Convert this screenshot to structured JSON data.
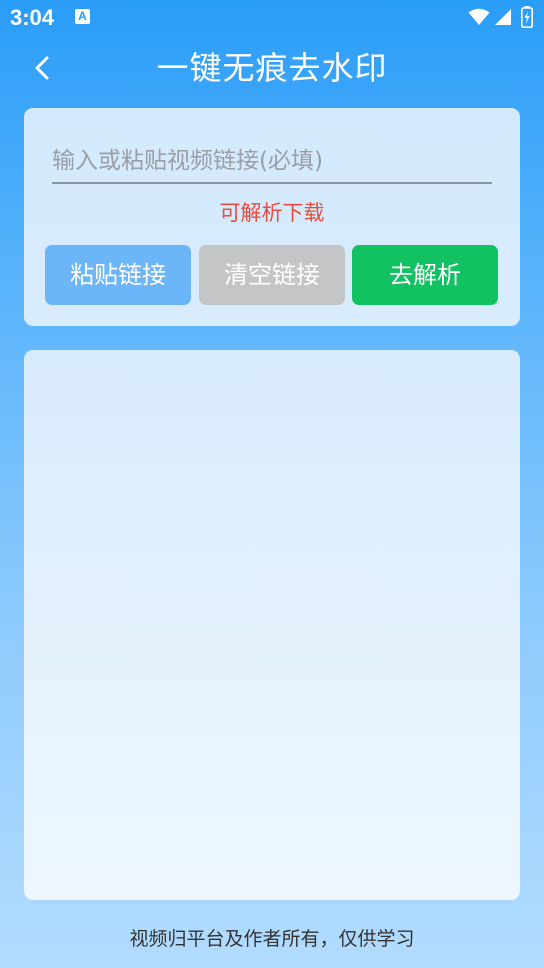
{
  "status_bar": {
    "time": "3:04",
    "notification_icon": "a-notification-icon",
    "wifi_icon": "wifi-icon",
    "signal_icon": "signal-icon",
    "battery_icon": "battery-icon"
  },
  "header": {
    "back_icon": "back-arrow-icon",
    "title": "一键无痕去水印"
  },
  "input_card": {
    "link_input": {
      "value": "",
      "placeholder": "输入或粘贴视频链接(必填)"
    },
    "status_message": "可解析下载",
    "buttons": {
      "paste_label": "粘贴链接",
      "clear_label": "清空链接",
      "parse_label": "去解析"
    }
  },
  "footer": {
    "note": "视频归平台及作者所有，仅供学习"
  },
  "colors": {
    "background_top": "#2a9df8",
    "background_bottom": "#b2dcfe",
    "paste_button": "#6cb5f8",
    "clear_button": "#c4c5c7",
    "parse_button": "#12c161",
    "status_message": "#e74c3c"
  }
}
